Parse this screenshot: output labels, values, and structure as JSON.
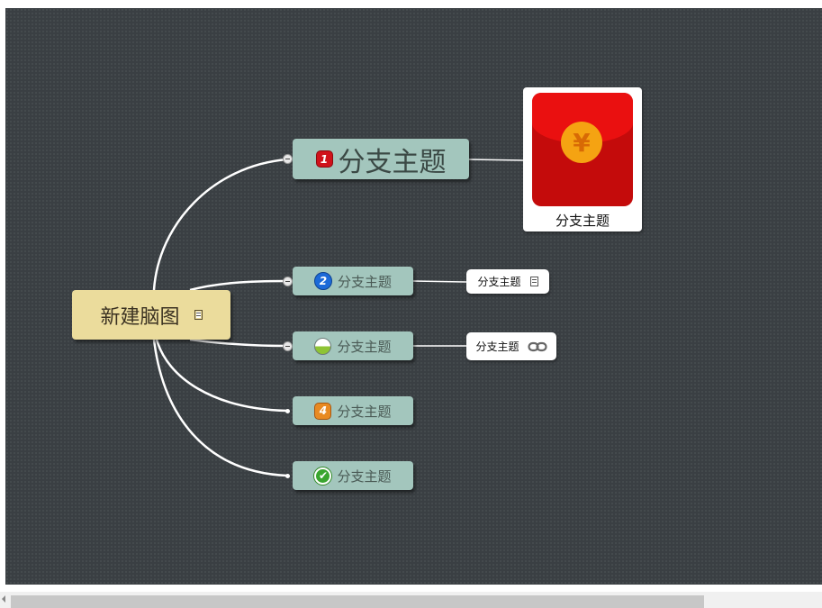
{
  "root": {
    "label": "新建脑图",
    "icon": "note-icon"
  },
  "branches": [
    {
      "label": "分支主题",
      "marker": "priority-1-icon",
      "marker_text": "1"
    },
    {
      "label": "分支主题",
      "marker": "priority-2-icon",
      "marker_text": "2"
    },
    {
      "label": "分支主题",
      "marker": "half-progress-icon",
      "marker_text": ""
    },
    {
      "label": "分支主题",
      "marker": "priority-4-icon",
      "marker_text": "4"
    },
    {
      "label": "分支主题",
      "marker": "check-icon",
      "marker_text": "✔"
    }
  ],
  "image_topic": {
    "label": "分支主题",
    "image": "red-envelope-image",
    "coin_symbol": "¥"
  },
  "subtopics": [
    {
      "label": "分支主题",
      "icon": "note-icon"
    },
    {
      "label": "分支主题",
      "icon": "link-icon"
    }
  ],
  "colors": {
    "canvas": "#3a3f43",
    "root_fill": "#ebdc9c",
    "branch_fill": "#a3c6bd",
    "connector": "#ffffff"
  }
}
